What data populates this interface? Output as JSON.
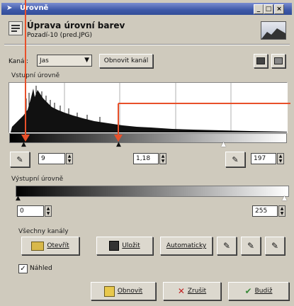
{
  "window": {
    "title": "Úrovně"
  },
  "header": {
    "title": "Úprava úrovní barev",
    "subtitle": "Pozadí-10 (pred.JPG)"
  },
  "channel": {
    "label": "Kanál:",
    "value": "Jas",
    "reset_label": "Obnovit kanál"
  },
  "input_levels": {
    "label": "Vstupní úrovně",
    "low": "9",
    "gamma": "1,18",
    "high": "197"
  },
  "output_levels": {
    "label": "Výstupní úrovně",
    "low": "0",
    "high": "255"
  },
  "all_channels": {
    "label": "Všechny kanály",
    "open_label": "Otevřít",
    "save_label": "Uložit",
    "auto_label": "Automaticky"
  },
  "preview": {
    "label": "Náhled",
    "checked": true
  },
  "buttons": {
    "reset": "Obnovit",
    "cancel": "Zrušit",
    "ok": "Budiž"
  },
  "colors": {
    "title_bar": "#3d58a8",
    "annotation": "#e8502a"
  }
}
